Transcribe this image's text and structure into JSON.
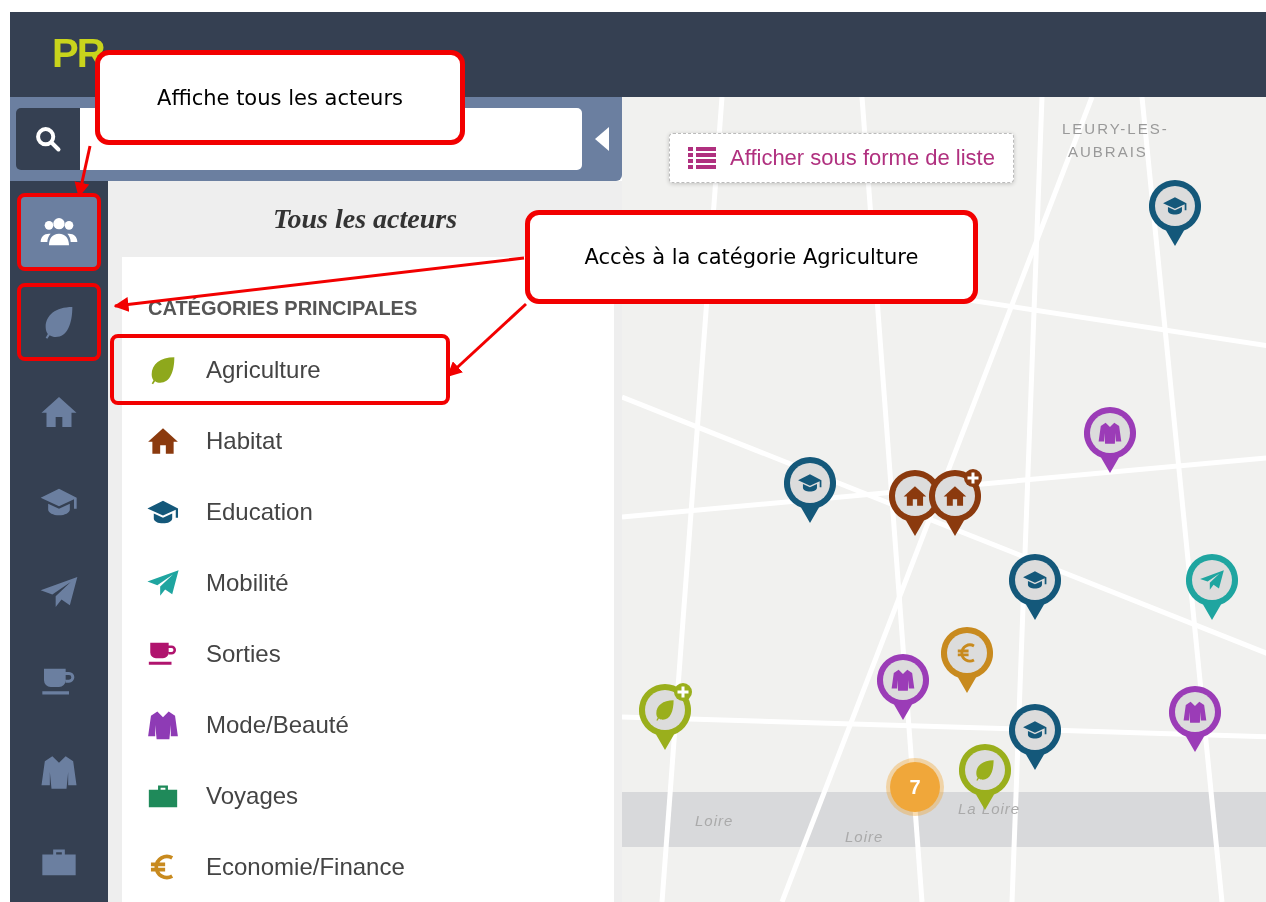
{
  "logo": {
    "text": "PR"
  },
  "search": {
    "collapsed": false
  },
  "rail": [
    {
      "kind": "people",
      "selected": true,
      "highlighted": true
    },
    {
      "kind": "leaf",
      "selected": false,
      "highlighted": true
    },
    {
      "kind": "house",
      "selected": false,
      "highlighted": false
    },
    {
      "kind": "cap",
      "selected": false,
      "highlighted": false
    },
    {
      "kind": "plane",
      "selected": false,
      "highlighted": false
    },
    {
      "kind": "cup",
      "selected": false,
      "highlighted": false
    },
    {
      "kind": "jacket",
      "selected": false,
      "highlighted": false
    },
    {
      "kind": "briefcase",
      "selected": false,
      "highlighted": false
    }
  ],
  "panel": {
    "title": "Tous les acteurs",
    "section_heading": "CATÉGORIES PRINCIPALES",
    "categories": [
      {
        "kind": "leaf",
        "label": "Agriculture",
        "color": "#8ea81c",
        "highlighted": true
      },
      {
        "kind": "house",
        "label": "Habitat",
        "color": "#8b3a0e",
        "highlighted": false
      },
      {
        "kind": "cap",
        "label": "Education",
        "color": "#14587a",
        "highlighted": false
      },
      {
        "kind": "plane",
        "label": "Mobilité",
        "color": "#1fa5a0",
        "highlighted": false
      },
      {
        "kind": "cup",
        "label": "Sorties",
        "color": "#b0146e",
        "highlighted": false
      },
      {
        "kind": "jacket",
        "label": "Mode/Beauté",
        "color": "#8e3bb5",
        "highlighted": false
      },
      {
        "kind": "briefcase",
        "label": "Voyages",
        "color": "#1f8a5a",
        "highlighted": false
      },
      {
        "kind": "euro",
        "label": "Economie/Finance",
        "color": "#c88a1e",
        "highlighted": false
      }
    ]
  },
  "map": {
    "list_button": "Afficher sous forme de liste",
    "labels": [
      "LEURY-LES-",
      "AUBRAIS",
      "La Loire",
      "Loire",
      "Loire"
    ],
    "markers": [
      {
        "kind": "cap",
        "color": "#14587a",
        "plus": false
      },
      {
        "kind": "jacket",
        "color": "#9b3cb7",
        "plus": false
      },
      {
        "kind": "cap",
        "color": "#14587a",
        "plus": false
      },
      {
        "kind": "house_pair",
        "color": "#8b3a0e",
        "plus": true
      },
      {
        "kind": "cap",
        "color": "#14587a",
        "plus": false
      },
      {
        "kind": "plane",
        "color": "#1fa5a0",
        "plus": false
      },
      {
        "kind": "euro",
        "color": "#c88a1e",
        "plus": false
      },
      {
        "kind": "jacket",
        "color": "#9b3cb7",
        "plus": false
      },
      {
        "kind": "leaf",
        "color": "#9aaf1c",
        "plus": true
      },
      {
        "kind": "jacket",
        "color": "#9b3cb7",
        "plus": false
      },
      {
        "kind": "cap",
        "color": "#14587a",
        "plus": false
      },
      {
        "kind": "leaf",
        "color": "#9aaf1c",
        "plus": false
      },
      {
        "kind": "cluster",
        "count": "7",
        "color": "#f0a73a"
      }
    ]
  },
  "callouts": [
    {
      "text": "Affiche tous les acteurs"
    },
    {
      "text": "Accès à la catégorie Agriculture"
    }
  ]
}
